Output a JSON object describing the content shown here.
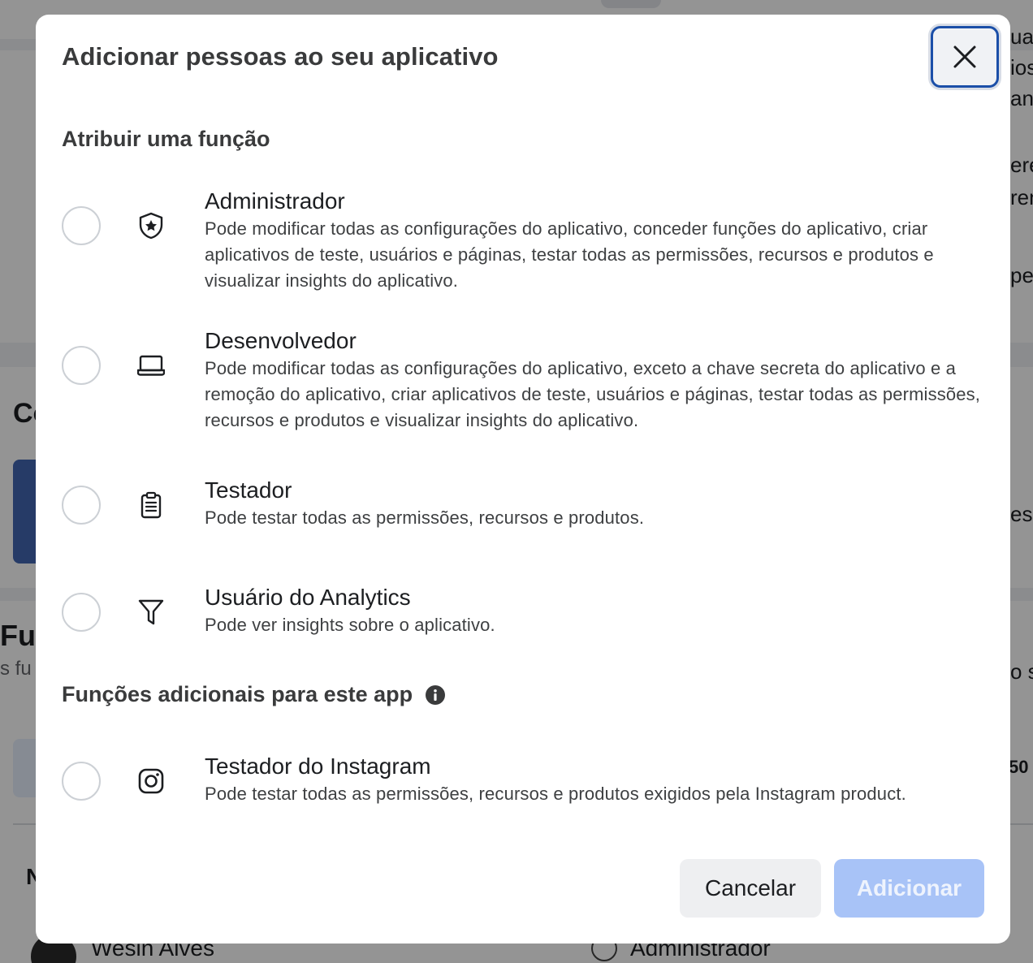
{
  "background": {
    "section_heading_partial": "Co",
    "roles_heading_partial": "Fun",
    "roles_sub_partial": "s fu",
    "column_partial": "N",
    "user_name": "Wesin Alves",
    "user_role": "Administrador",
    "right_edge_fragments": [
      "ua",
      "ios",
      "an",
      "ere",
      "ren",
      "pes",
      "ess",
      "o s",
      "50"
    ]
  },
  "modal": {
    "title": "Adicionar pessoas ao seu aplicativo",
    "close_icon": "close-icon",
    "section_assign": "Atribuir uma função",
    "roles": [
      {
        "id": "administrador",
        "icon": "shield-star-icon",
        "name": "Administrador",
        "description": "Pode modificar todas as configurações do aplicativo, conceder funções do aplicativo, criar aplicativos de teste, usuários e páginas, testar todas as permissões, recursos e produtos e visualizar insights do aplicativo."
      },
      {
        "id": "desenvolvedor",
        "icon": "laptop-icon",
        "name": "Desenvolvedor",
        "description": "Pode modificar todas as configurações do aplicativo, exceto a chave secreta do aplicativo e a remoção do aplicativo, criar aplicativos de teste, usuários e páginas, testar todas as permissões, recursos e produtos e visualizar insights do aplicativo."
      },
      {
        "id": "testador",
        "icon": "clipboard-icon",
        "name": "Testador",
        "description": "Pode testar todas as permissões, recursos e produtos."
      },
      {
        "id": "analytics",
        "icon": "funnel-icon",
        "name": "Usuário do Analytics",
        "description": "Pode ver insights sobre o aplicativo."
      }
    ],
    "section_additional": "Funções adicionais para este app",
    "additional_roles": [
      {
        "id": "instagram",
        "icon": "instagram-icon",
        "name": "Testador do Instagram",
        "description": "Pode testar todas as permissões, recursos e produtos exigidos pela Instagram product."
      }
    ],
    "cancel_label": "Cancelar",
    "add_label": "Adicionar"
  },
  "colors": {
    "add_button_disabled": "#a8c3f7",
    "close_focus_ring": "#1b4fa8",
    "brand_blue": "#4267b2"
  }
}
